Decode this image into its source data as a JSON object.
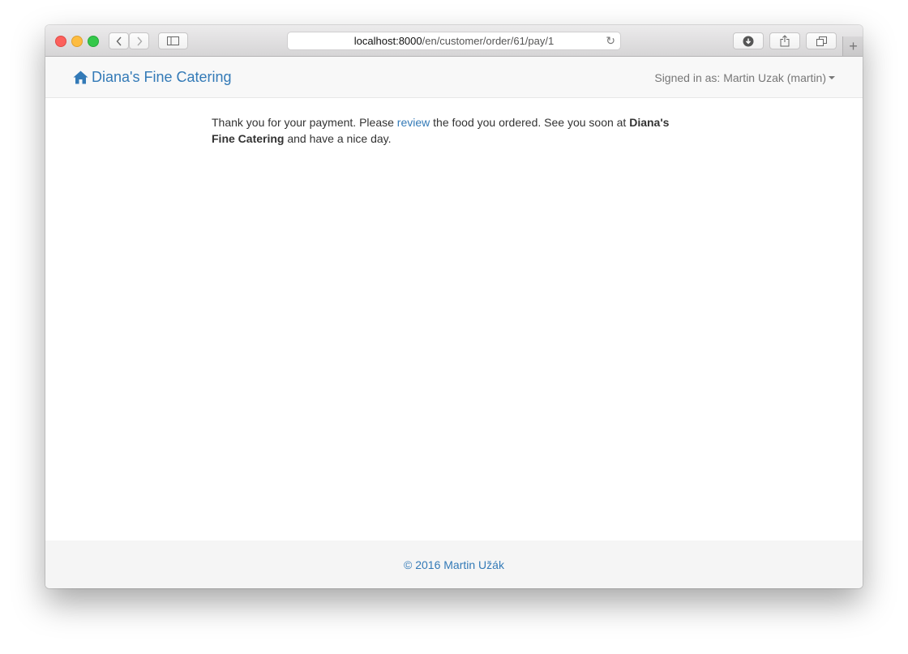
{
  "browser": {
    "url_host": "localhost:8000",
    "url_path": "/en/customer/order/61/pay/1"
  },
  "navbar": {
    "brand": "Diana's Fine Catering",
    "brand_icon": "home-icon",
    "user_menu": "Signed in as: Martin Uzak (martin)"
  },
  "message": {
    "part1": "Thank you for your payment. Please ",
    "link": "review",
    "part2": " the food you ordered. See you soon at ",
    "bold": "Diana's Fine Catering",
    "part3": " and have a nice day."
  },
  "footer": {
    "copyright": "© 2016 Martin Užák"
  },
  "colors": {
    "link": "#337ab7",
    "navbar_bg": "#f8f8f8",
    "footer_bg": "#f5f5f5"
  }
}
